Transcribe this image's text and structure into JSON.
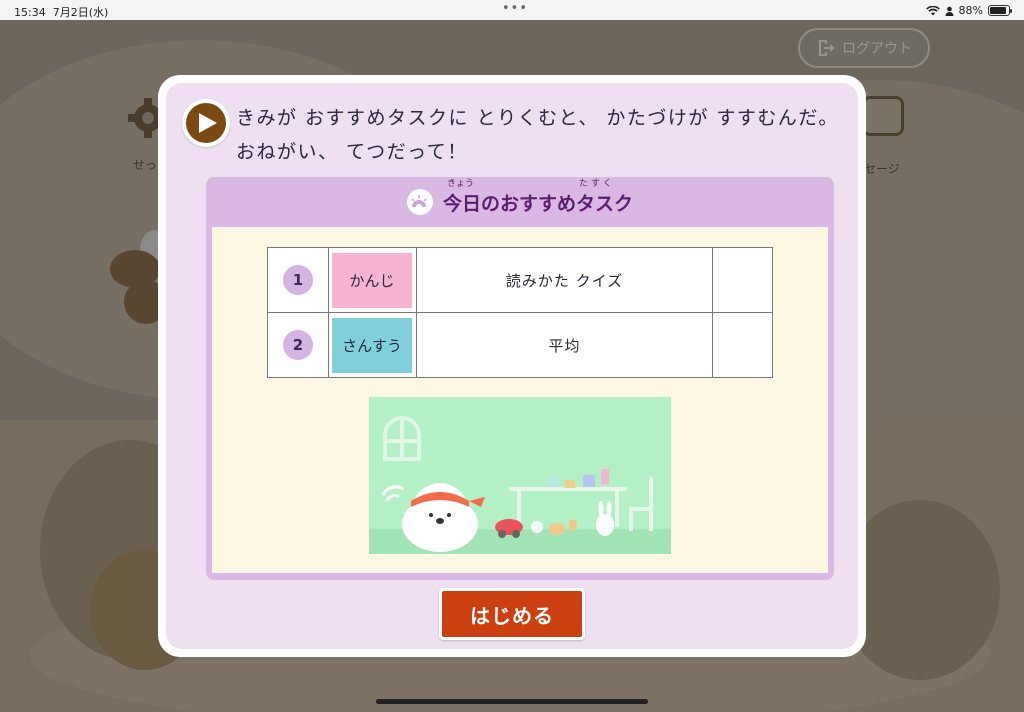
{
  "status_bar": {
    "time": "15:34",
    "date": "7月2日(水)",
    "battery": "88%",
    "battery_level": 0.88
  },
  "background": {
    "logout_label": "ログアウト",
    "left_menu_label": "せっ",
    "right_menu_label": "セージ"
  },
  "modal": {
    "intro_text": "きみが おすすめタスクに とりくむと、 かたづけが すすむんだ。 おねがい、 てつだって！",
    "panel_title": "今日のおすすめタスク",
    "title_ruby_1": "きょう",
    "title_ruby_2": "た す く",
    "tasks": [
      {
        "number": "1",
        "subject": "かんじ",
        "subject_color": "#f6b3d2",
        "name": "読みかた クイズ"
      },
      {
        "number": "2",
        "subject": "さんすう",
        "subject_color": "#7fd0dc",
        "name": "平均"
      }
    ],
    "start_label": "はじめる"
  },
  "colors": {
    "modal_bg": "#eee0f1",
    "panel_header": "#d9b8e3",
    "panel_body": "#fcf8e3",
    "start_button": "#cc3f10",
    "illustration_bg": "#b3f0c6"
  },
  "icons": {
    "play": "play-icon",
    "sun": "sun-icon",
    "logout": "logout-icon",
    "gear": "gear-icon",
    "message": "message-icon"
  }
}
